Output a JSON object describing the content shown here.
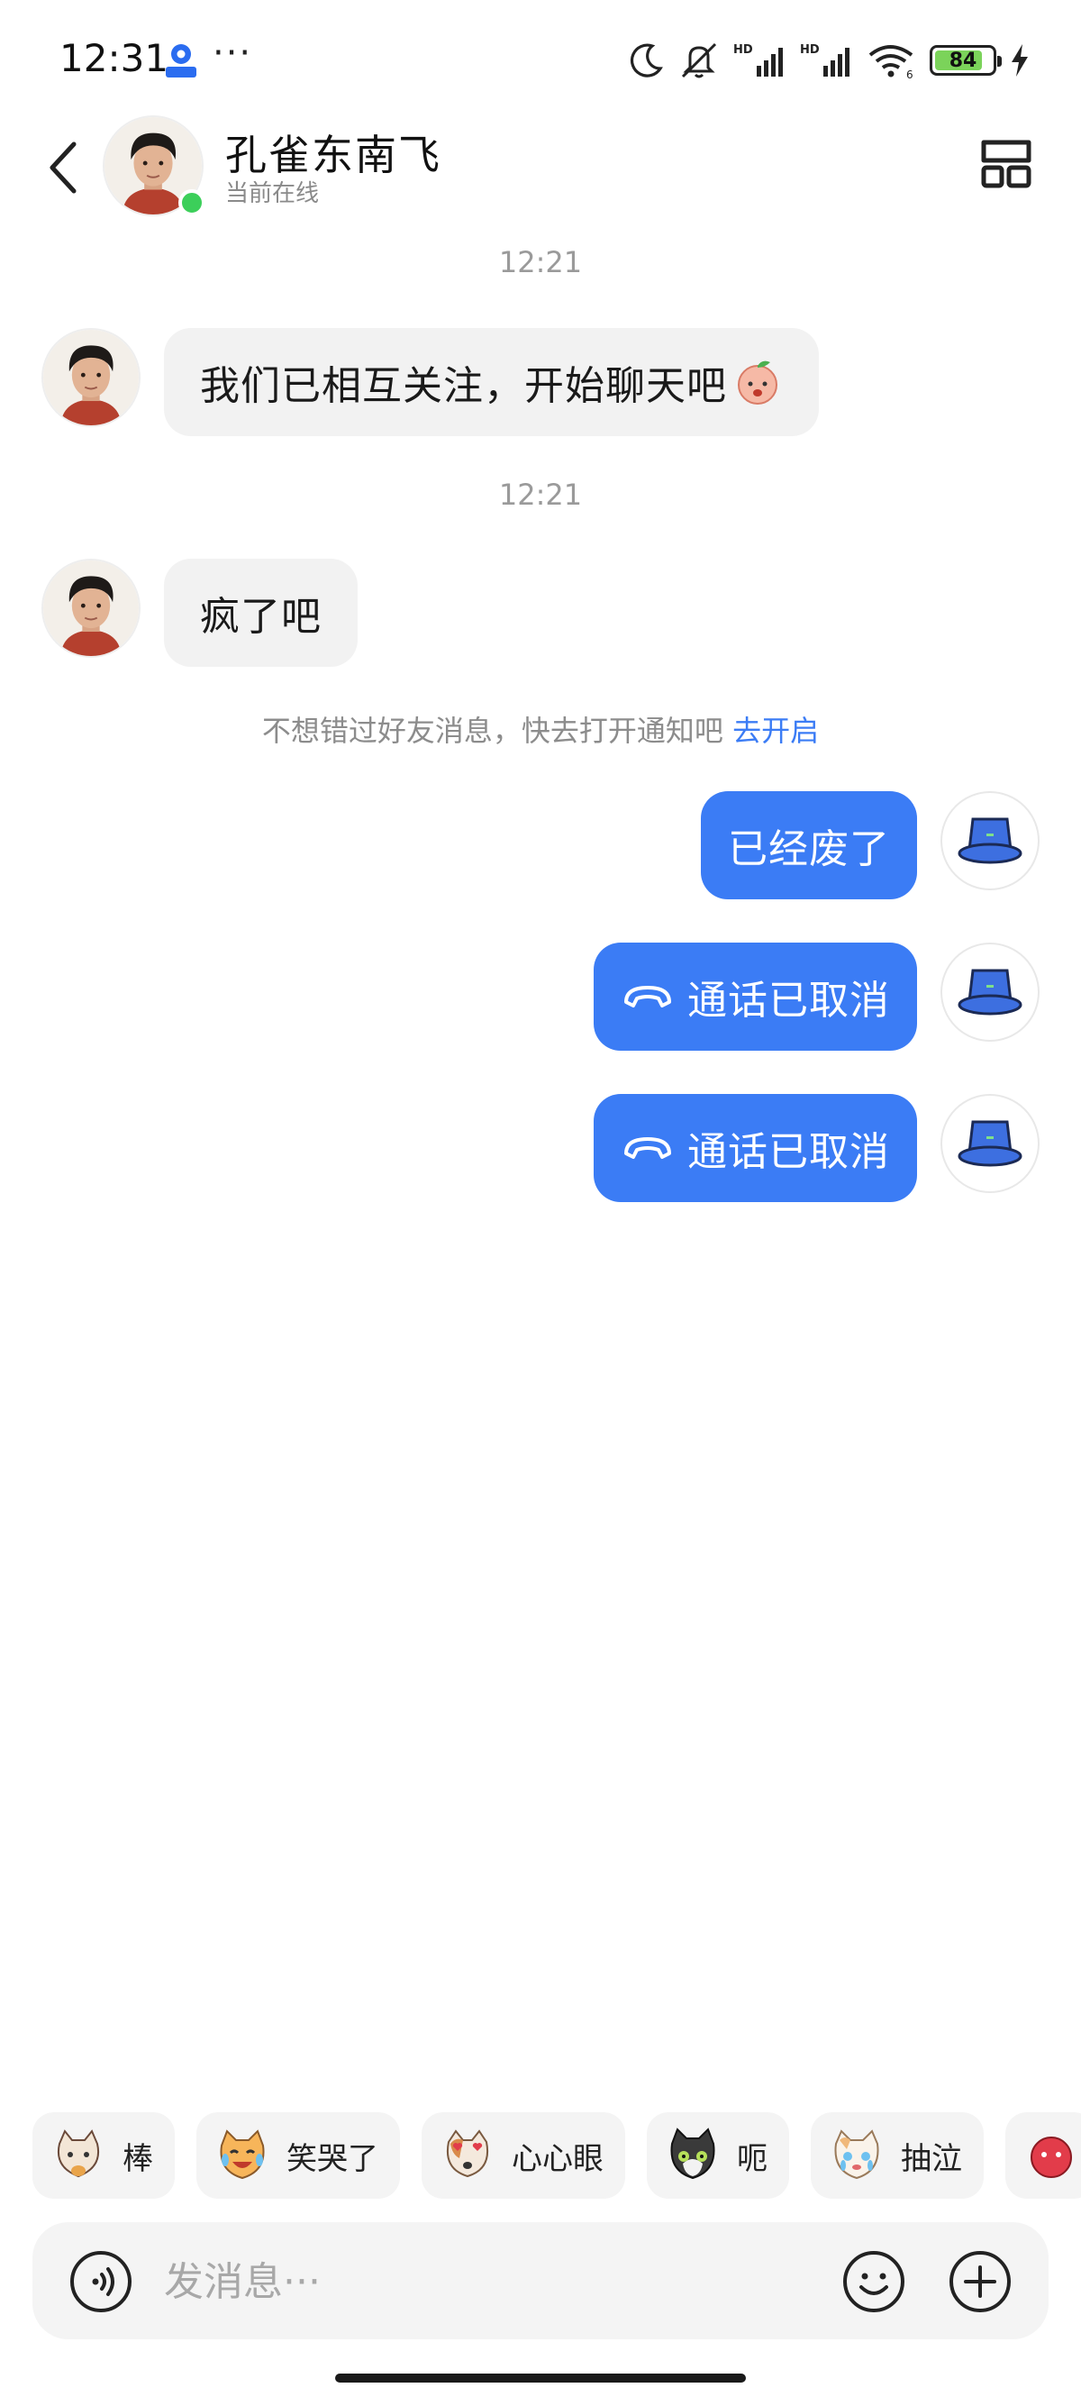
{
  "status_bar": {
    "time": "12:31",
    "app_icon": "map-app-icon",
    "more": "···",
    "battery_level": 84,
    "icons": [
      "moon-icon",
      "mute-icon",
      "hd-signal-icon",
      "hd-signal-icon",
      "wifi-icon",
      "battery-icon",
      "charging-icon"
    ]
  },
  "header": {
    "contact_name": "孔雀东南飞",
    "status": "当前在线",
    "online": true,
    "back_icon": "chevron-left-icon",
    "menu_icon": "dashboard-icon"
  },
  "messages": [
    {
      "type": "timestamp",
      "text": "12:21"
    },
    {
      "type": "incoming",
      "text": "我们已相互关注，开始聊天吧",
      "emoji": "peach-emoji-icon"
    },
    {
      "type": "timestamp",
      "text": "12:21"
    },
    {
      "type": "incoming",
      "text": "疯了吧"
    },
    {
      "type": "notice",
      "text": "不想错过好友消息，快去打开通知吧",
      "link": "去开启"
    },
    {
      "type": "outgoing",
      "text": "已经废了"
    },
    {
      "type": "outgoing",
      "text": "通话已取消",
      "icon": "phone-hangup-icon"
    },
    {
      "type": "outgoing",
      "text": "通话已取消",
      "icon": "phone-hangup-icon"
    }
  ],
  "stickers": [
    {
      "label": "棒",
      "icon": "cat-thumbs-up-icon"
    },
    {
      "label": "笑哭了",
      "icon": "cat-laugh-cry-icon"
    },
    {
      "label": "心心眼",
      "icon": "dog-heart-eyes-icon"
    },
    {
      "label": "呃",
      "icon": "cat-awkward-icon"
    },
    {
      "label": "抽泣",
      "icon": "cat-sob-icon"
    }
  ],
  "input": {
    "placeholder": "发消息···",
    "voice_icon": "voice-icon",
    "emoji_icon": "smiley-icon",
    "plus_icon": "plus-icon"
  },
  "colors": {
    "accent": "#3b7cf5",
    "bubble_in": "#f2f2f2",
    "online": "#3ccf5a"
  }
}
